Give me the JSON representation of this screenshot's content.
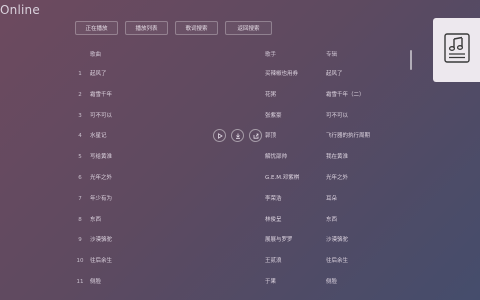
{
  "app": {
    "title": "Online"
  },
  "toolbar": {
    "buttons": [
      "正在播放",
      "播放列表",
      "歌词搜索",
      "返回搜索"
    ]
  },
  "table": {
    "headers": {
      "name": "歌曲",
      "artist": "歌手",
      "album": "专辑"
    },
    "rows": [
      {
        "num": "1",
        "name": "起风了",
        "artist": "买辣椒也用券",
        "album": "起风了"
      },
      {
        "num": "2",
        "name": "霜雪千年",
        "artist": "花粥",
        "album": "霜雪千年（二）"
      },
      {
        "num": "3",
        "name": "可不可以",
        "artist": "张紫豪",
        "album": "可不可以"
      },
      {
        "num": "4",
        "name": "水星记",
        "artist": "郭顶",
        "album": "飞行器的执行周期"
      },
      {
        "num": "5",
        "name": "写给黄淮",
        "artist": "解忧邵帅",
        "album": "我在黄淮"
      },
      {
        "num": "6",
        "name": "光年之外",
        "artist": "G.E.M.邓紫棋",
        "album": "光年之外"
      },
      {
        "num": "7",
        "name": "年少有为",
        "artist": "李荣浩",
        "album": "耳朵"
      },
      {
        "num": "8",
        "name": "东西",
        "artist": "林俊呈",
        "album": "东西"
      },
      {
        "num": "9",
        "name": "沙漠骆驼",
        "artist": "展展与罗罗",
        "album": "沙漠骆驼"
      },
      {
        "num": "10",
        "name": "往后余生",
        "artist": "王贰浪",
        "album": "往后余生"
      },
      {
        "num": "11",
        "name": "侧脸",
        "artist": "于果",
        "album": "侧脸"
      }
    ]
  },
  "icons": {
    "play": "play-icon",
    "download": "download-icon",
    "share": "share-icon",
    "album": "music-note-icon"
  }
}
